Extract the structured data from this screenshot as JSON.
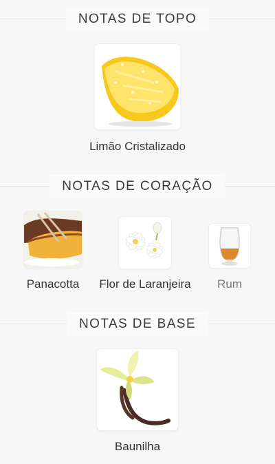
{
  "sections": {
    "top": {
      "title": "NOTAS DE TOPO",
      "notes": [
        {
          "label": "Limão Cristalizado",
          "icon": "candied-lemon-icon"
        }
      ]
    },
    "heart": {
      "title": "NOTAS DE CORAÇÃO",
      "notes": [
        {
          "label": "Panacotta",
          "icon": "panacotta-icon"
        },
        {
          "label": "Flor de Laranjeira",
          "icon": "orange-blossom-icon"
        },
        {
          "label": "Rum",
          "icon": "rum-glass-icon"
        }
      ]
    },
    "base": {
      "title": "NOTAS DE BASE",
      "notes": [
        {
          "label": "Baunilha",
          "icon": "vanilla-icon"
        }
      ]
    }
  },
  "colors": {
    "background": "#f7f7f7",
    "divider": "#e6e6e6",
    "text": "#333333"
  }
}
